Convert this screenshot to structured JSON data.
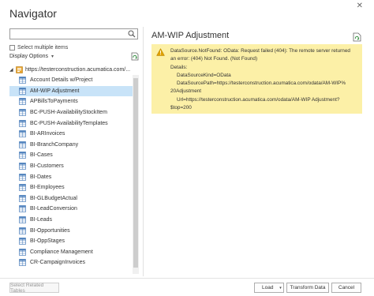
{
  "window": {
    "title": "Navigator",
    "close_glyph": "✕"
  },
  "search": {
    "value": "",
    "placeholder": ""
  },
  "select_multiple": {
    "label": "Select multiple items",
    "checked": false
  },
  "display_options": {
    "label": "Display Options",
    "chevron": "▾"
  },
  "tree": {
    "root_label": "https://testerconstruction.acumatica.com/...",
    "root_toggle": "◢",
    "selected_index": 1,
    "items": [
      {
        "label": "Account Details w/Project"
      },
      {
        "label": "AM-WIP Adjustment"
      },
      {
        "label": "APBillsToPayments"
      },
      {
        "label": "BC-PUSH-AvailabilityStockItem"
      },
      {
        "label": "BC-PUSH-AvailabilityTemplates"
      },
      {
        "label": "BI-ARInvoices"
      },
      {
        "label": "BI-BranchCompany"
      },
      {
        "label": "BI-Cases"
      },
      {
        "label": "BI-Customers"
      },
      {
        "label": "BI-Dates"
      },
      {
        "label": "BI-Employees"
      },
      {
        "label": "BI-GLBudgetActual"
      },
      {
        "label": "BI-LeadConversion"
      },
      {
        "label": "BI-Leads"
      },
      {
        "label": "BI-Opportunities"
      },
      {
        "label": "BI-OppStages"
      },
      {
        "label": "Compliance Management"
      },
      {
        "label": "CR-CampaignInvoices"
      }
    ]
  },
  "preview": {
    "title": "AM-WIP Adjustment",
    "error": {
      "line1": "DataSource.NotFound: OData: Request failed (404): The remote server returned",
      "line2": "an error: (404) Not Found. (Not Found)",
      "line3": "Details:",
      "line4": "DataSourceKind=OData",
      "line5": "DataSourcePath=https://testerconstruction.acumatica.com/odata/AM-WIP%",
      "line6": "20Adjustment",
      "line7": "Url=https://testerconstruction.acumatica.com/odata/AM-WIP Adjustment?",
      "line8": "$top=200"
    }
  },
  "footer": {
    "select_related_label": "Select Related Tables",
    "load_label": "Load",
    "load_split_glyph": "▾",
    "transform_label": "Transform Data",
    "cancel_label": "Cancel"
  },
  "colors": {
    "selected_row": "#c8e3f8",
    "error_bg": "#fcf0a7",
    "warning_icon": "#e0a100",
    "table_icon": "#4a7ebb"
  }
}
